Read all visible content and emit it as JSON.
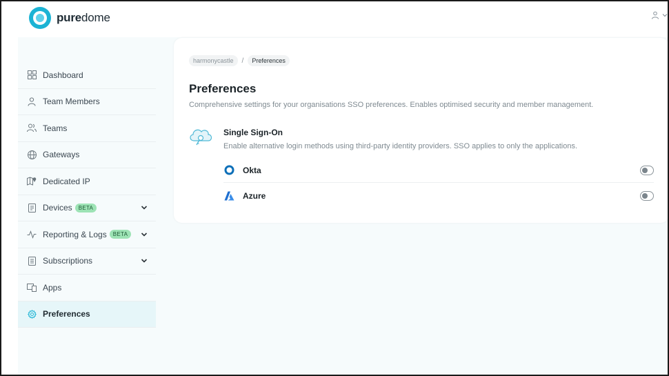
{
  "brand": {
    "name_bold": "pure",
    "name_rest": "dome"
  },
  "sidebar": {
    "items": [
      {
        "label": "Dashboard",
        "icon": "dashboard-icon"
      },
      {
        "label": "Team Members",
        "icon": "user-icon"
      },
      {
        "label": "Teams",
        "icon": "users-icon"
      },
      {
        "label": "Gateways",
        "icon": "globe-icon"
      },
      {
        "label": "Dedicated IP",
        "icon": "map-pin-icon"
      },
      {
        "label": "Devices",
        "icon": "device-icon",
        "badge": "BETA"
      },
      {
        "label": "Reporting & Logs",
        "icon": "activity-icon",
        "badge": "BETA"
      },
      {
        "label": "Subscriptions",
        "icon": "subscription-icon"
      },
      {
        "label": "Apps",
        "icon": "apps-icon"
      },
      {
        "label": "Preferences",
        "icon": "gear-icon",
        "active": true
      }
    ]
  },
  "breadcrumb": {
    "root": "harmonycastle",
    "separator": "/",
    "current": "Preferences"
  },
  "main": {
    "title": "Preferences",
    "description": "Comprehensive settings for your organisations SSO preferences. Enables optimised security and member management.",
    "sso": {
      "title": "Single Sign-On",
      "description": "Enable alternative login methods using third-party identity providers. SSO applies to only the applications.",
      "providers": [
        {
          "name": "Okta",
          "enabled": false
        },
        {
          "name": "Azure",
          "enabled": false
        }
      ]
    }
  },
  "colors": {
    "accent": "#1bb3d4",
    "active_bg": "#e6f6f9",
    "badge_bg": "#9de3b5",
    "okta": "#0d6fb8",
    "azure": "#1f6fd0"
  }
}
